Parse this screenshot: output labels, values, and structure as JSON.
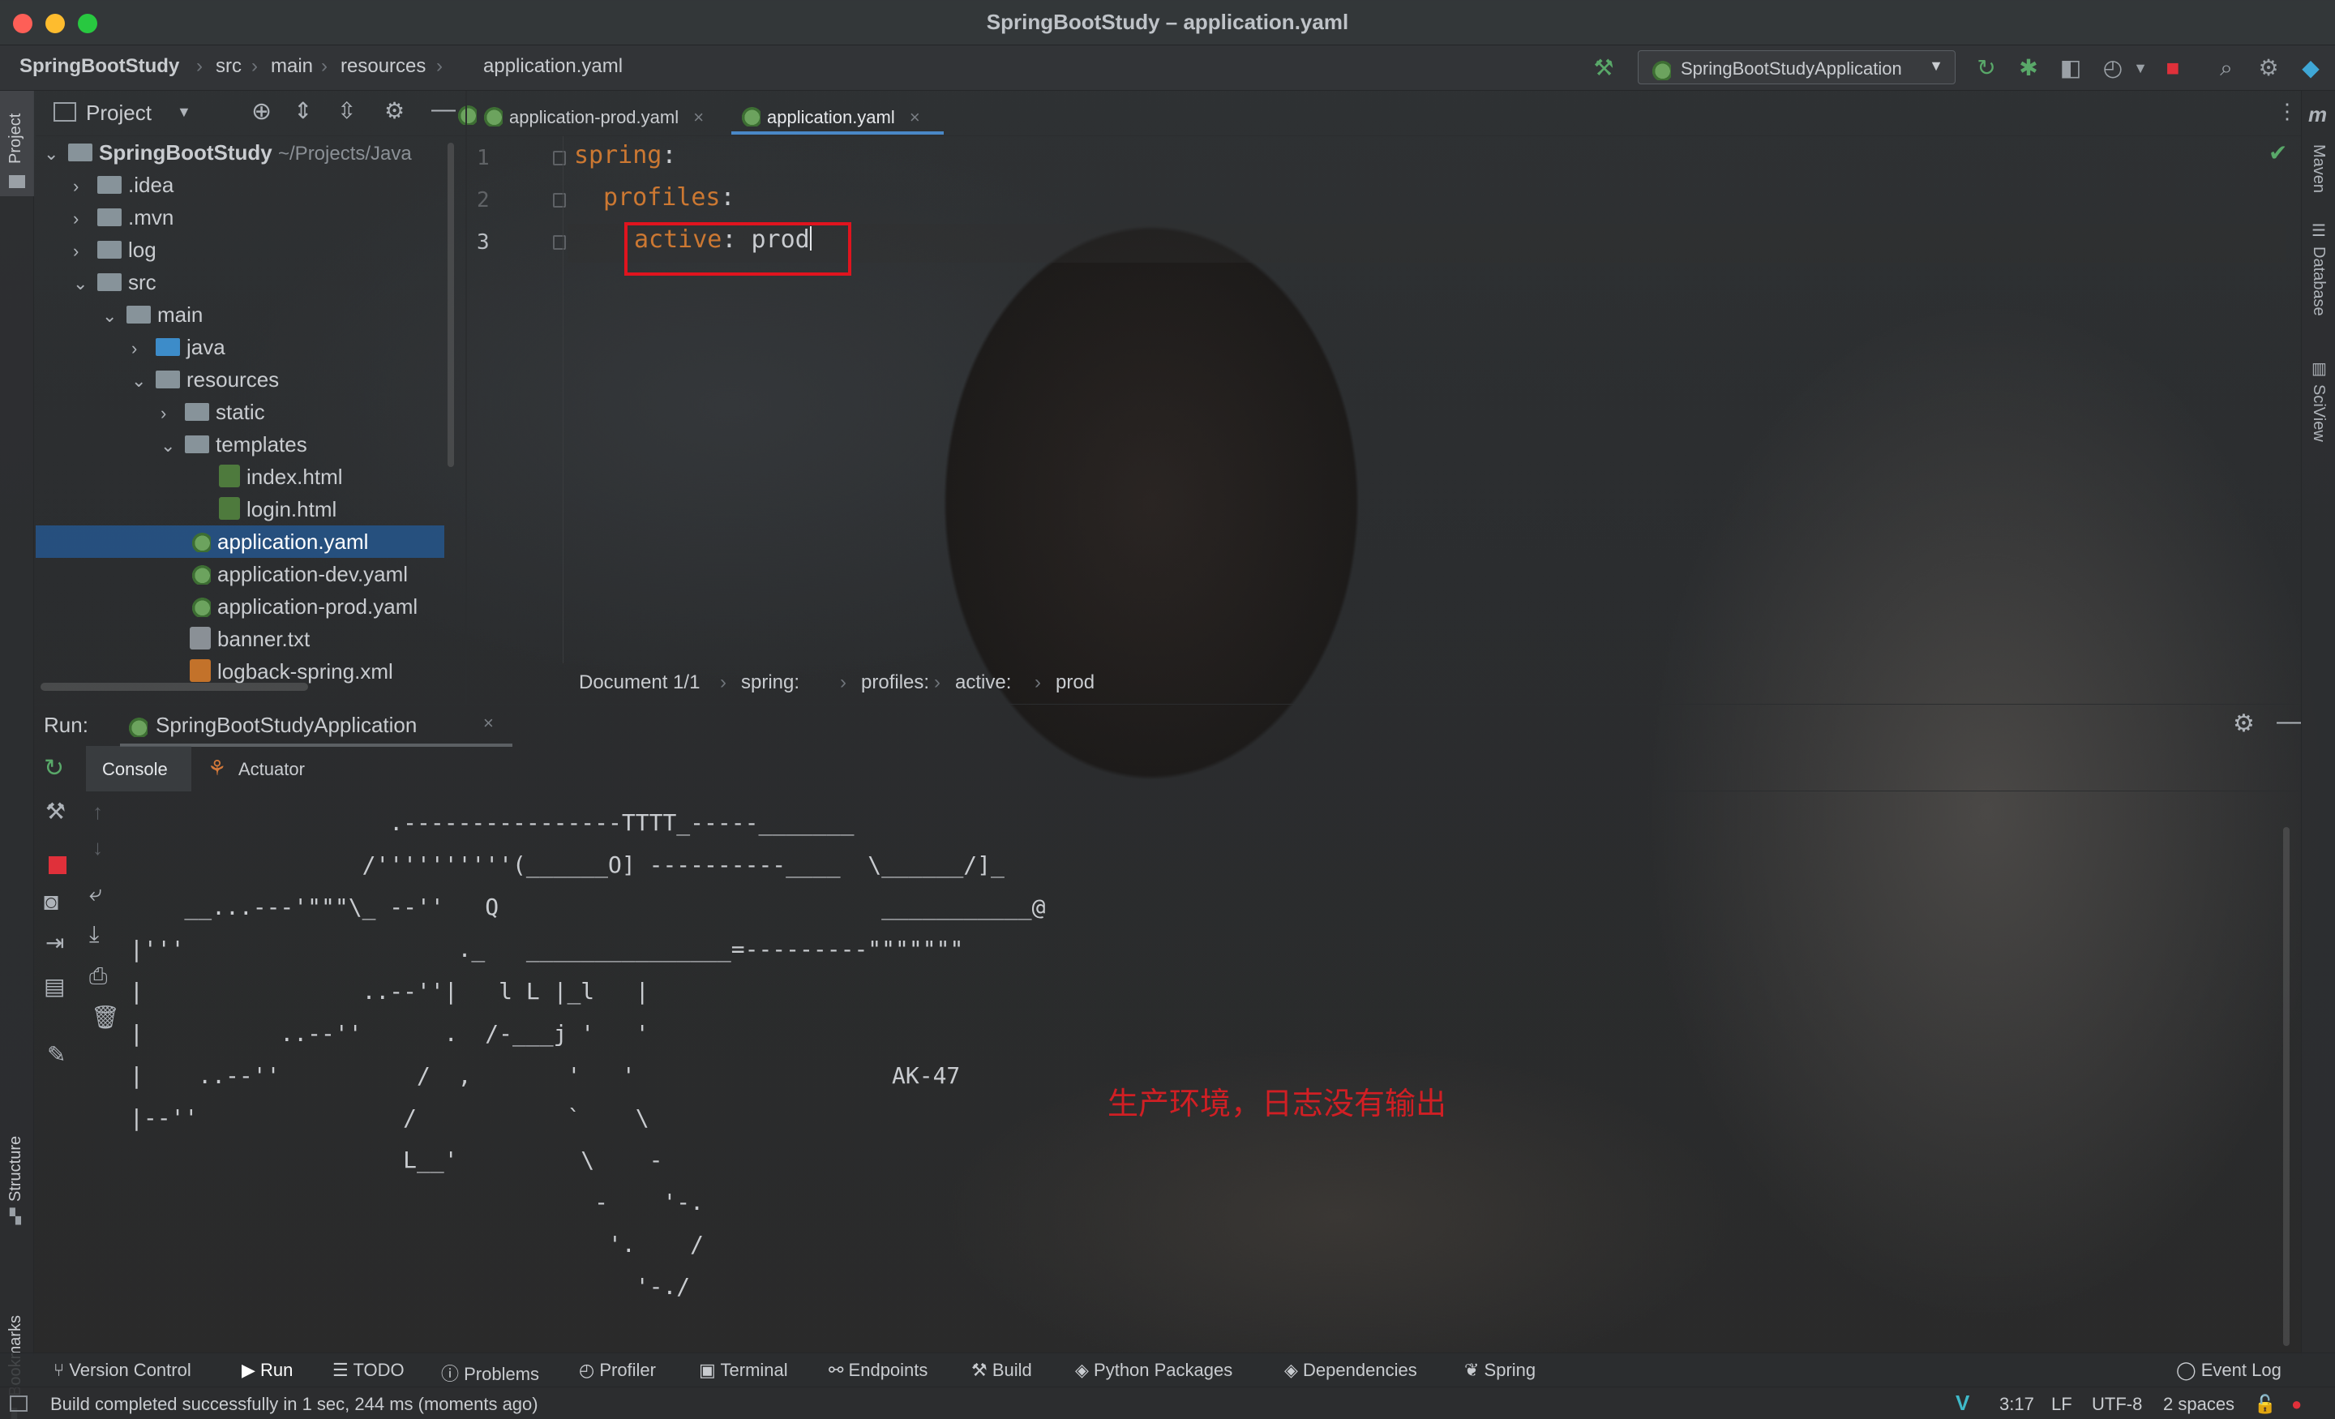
{
  "window": {
    "title": "SpringBootStudy – application.yaml"
  },
  "breadcrumb": [
    "SpringBootStudy",
    "src",
    "main",
    "resources",
    "application.yaml"
  ],
  "run_config": {
    "label": "SpringBootStudyApplication"
  },
  "colors": {
    "accent": "#4a88c7",
    "highlight_box": "#e0141e",
    "annotation": "#d01f24",
    "yaml_key": "#cc7832",
    "success_check": "#59a869",
    "selection": "#26568c"
  },
  "toolbar_icons": [
    "hammer-icon",
    "rerun-icon",
    "debug-icon",
    "coverage-icon",
    "profile-icon",
    "stop-icon",
    "search-icon",
    "settings-icon",
    "jetbrains-icon"
  ],
  "left_stripe": {
    "project": "Project",
    "structure": "Structure",
    "bookmarks": "Bookmarks"
  },
  "right_stripe": {
    "maven": "Maven",
    "database": "Database",
    "sciview": "SciView"
  },
  "project_panel": {
    "title": "Project",
    "root": {
      "name": "SpringBootStudy",
      "path": "~/Projects/Java"
    },
    "tree": [
      {
        "label": ".idea"
      },
      {
        "label": ".mvn"
      },
      {
        "label": "log"
      },
      {
        "label": "src"
      },
      {
        "label": "main"
      },
      {
        "label": "java"
      },
      {
        "label": "resources"
      },
      {
        "label": "static"
      },
      {
        "label": "templates"
      },
      {
        "label": "index.html"
      },
      {
        "label": "login.html"
      },
      {
        "label": "application.yaml"
      },
      {
        "label": "application-dev.yaml"
      },
      {
        "label": "application-prod.yaml"
      },
      {
        "label": "banner.txt"
      },
      {
        "label": "logback-spring.xml"
      }
    ]
  },
  "editor": {
    "tabs": [
      {
        "label": "application-prod.yaml",
        "active": false
      },
      {
        "label": "application.yaml",
        "active": true
      }
    ],
    "line_numbers": [
      "1",
      "2",
      "3"
    ],
    "lines": [
      {
        "key": "spring",
        "colon": ":",
        "value": ""
      },
      {
        "key": "profiles",
        "colon": ":",
        "value": ""
      },
      {
        "key": "active",
        "colon": ":",
        "value": " prod"
      }
    ],
    "breadcrumb": [
      "Document 1/1",
      "spring:",
      "profiles:",
      "active:",
      "prod"
    ]
  },
  "run_panel": {
    "label": "Run:",
    "config_tab": "SpringBootStudyApplication",
    "tabs": [
      "Console",
      "Actuator"
    ],
    "console_lines": [
      "                   .----------------TTTT_-----_______",
      "                 /''''''''''(______O] ----------____  \\______/]_",
      "    __...---'\"\"\"\\_ --''   Q                            ___________@",
      "|'''                    ._   _______________=---------\"\"\"\"\"\"\"",
      "|                ..--''|   l L |_l   |",
      "|          ..--''      .  /-___j '   '",
      "|    ..--''          /  ,       '   '",
      "|--''               /           `    \\",
      "                    L__'         \\    -",
      "                                  -    '-.",
      "                                   '.    /",
      "                                     '-./"
    ],
    "ascii_caption": "AK-47",
    "annotation": "生产环境，日志没有输出"
  },
  "bottom_tools": [
    "Version Control",
    "Run",
    "TODO",
    "Problems",
    "Profiler",
    "Terminal",
    "Endpoints",
    "Build",
    "Python Packages",
    "Dependencies",
    "Spring"
  ],
  "event_log": "Event Log",
  "status": {
    "message": "Build completed successfully in 1 sec, 244 ms (moments ago)",
    "position": "3:17",
    "line_sep": "LF",
    "encoding": "UTF-8",
    "indent": "2 spaces"
  }
}
